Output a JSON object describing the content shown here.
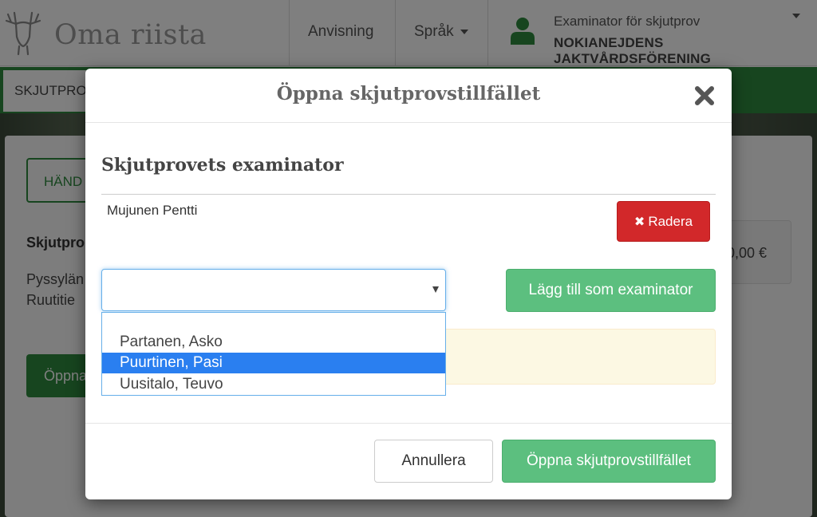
{
  "header": {
    "brand": "Oma riista",
    "nav_guide": "Anvisning",
    "nav_language": "Språk",
    "user_role": "Examinator för skjutprov",
    "user_org": "NOKIANEJDENS JAKTVÅRDSFÖRENING"
  },
  "background": {
    "active_tab": "SKJUTPRO",
    "panel_tab": "HÄND",
    "panel_title": "Skjutpro",
    "address_line1": "Pyssylän",
    "address_line2": "Ruutitie",
    "amount": "0,00 €",
    "action_button": "Öppna"
  },
  "modal": {
    "title": "Öppna skjutprovstillfället",
    "section_title": "Skjutprovets examinator",
    "examiner": {
      "name": "Mujunen Pentti",
      "delete_label": "Radera"
    },
    "select": {
      "value": "",
      "options": [
        {
          "label": "Partanen, Asko",
          "selected": false
        },
        {
          "label": "Puurtinen, Pasi",
          "selected": true
        },
        {
          "label": "Uusitalo, Teuvo",
          "selected": false
        }
      ]
    },
    "add_label": "Lägg till som examinator",
    "cancel_label": "Annullera",
    "open_label": "Öppna skjutprovstillfället"
  },
  "colors": {
    "brand_green": "#2e8b3e",
    "button_green": "#5cbf7f",
    "danger_red": "#d2282a",
    "select_highlight": "#2a7ff0",
    "warning_bg": "#fcf8e3"
  }
}
